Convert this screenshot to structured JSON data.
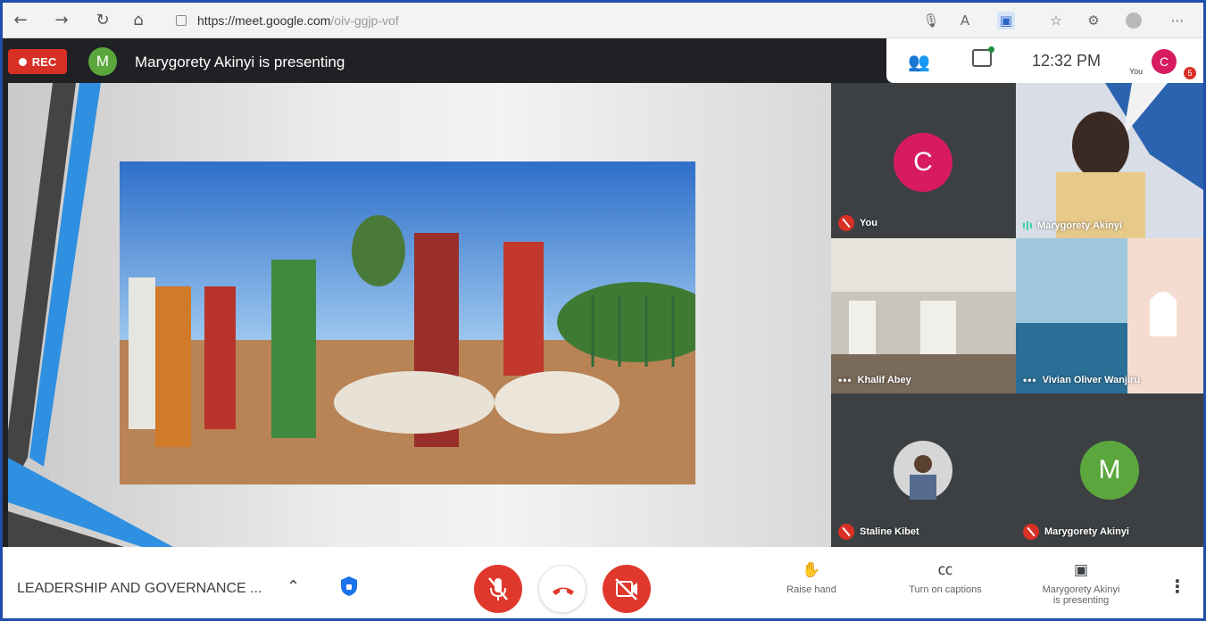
{
  "browser": {
    "url_domain": "https://meet.google.com",
    "url_path": "/oiv-ggjp-vof"
  },
  "header": {
    "rec_label": "REC",
    "presenter_initial": "M",
    "presenting_text": "Marygorety Akinyi is presenting",
    "time": "12:32 PM",
    "you_label": "You",
    "you_initial": "C",
    "notification_count": "5"
  },
  "tiles": [
    {
      "name": "You",
      "initial": "C",
      "avatar_color": "#d81b60",
      "muted": true
    },
    {
      "name": "Marygorety Akinyi",
      "speaking": true
    },
    {
      "name": "Khalif Abey"
    },
    {
      "name": "Vivian Oliver Wanjiru"
    },
    {
      "name": "Staline Kibet",
      "muted": true
    },
    {
      "name": "Marygorety Akinyi",
      "initial": "M",
      "avatar_color": "#5ba73d",
      "muted": true
    }
  ],
  "bottom": {
    "meeting_title": "LEADERSHIP AND GOVERNANCE ...",
    "raise_hand": "Raise hand",
    "captions": "Turn on captions",
    "presenting_line1": "Marygorety Akinyi",
    "presenting_line2": "is presenting"
  },
  "colors": {
    "accent_red": "#e0382c",
    "rec_red": "#d93025",
    "speaking_teal": "#3dd4b0"
  }
}
